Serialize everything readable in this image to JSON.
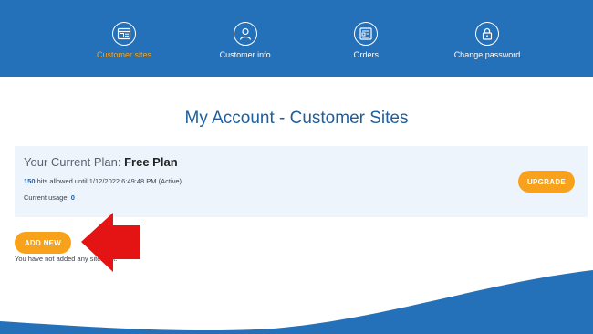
{
  "nav": {
    "items": [
      {
        "label": "Customer sites",
        "icon": "browser-window-icon",
        "active": true
      },
      {
        "label": "Customer info",
        "icon": "user-icon",
        "active": false
      },
      {
        "label": "Orders",
        "icon": "orders-document-icon",
        "active": false
      },
      {
        "label": "Change password",
        "icon": "lock-icon",
        "active": false
      }
    ],
    "active_color": "#f7a21b",
    "background": "#2470b9"
  },
  "page": {
    "title": "My Account - Customer Sites"
  },
  "plan": {
    "label": "Your Current Plan:",
    "name": "Free Plan",
    "hits_count": "150",
    "hits_text": "hits allowed until 1/12/2022 6:49:48 PM (Active)",
    "usage_label": "Current usage:",
    "usage_value": "0",
    "upgrade_label": "UPGRADE"
  },
  "sites": {
    "add_label": "ADD NEW",
    "empty_text": "You have not added any sites yet."
  },
  "colors": {
    "accent": "#f8a21c",
    "brand": "#2470b9",
    "callout_arrow": "#e51414"
  }
}
